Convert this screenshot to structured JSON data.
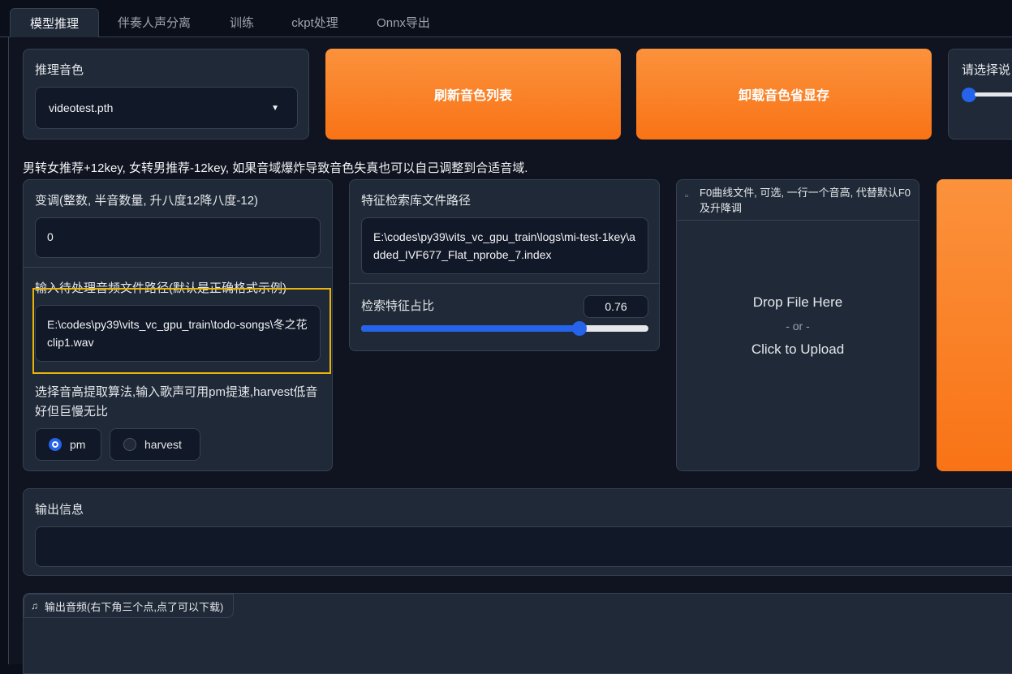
{
  "tabs": [
    "模型推理",
    "伴奏人声分离",
    "训练",
    "ckpt处理",
    "Onnx导出"
  ],
  "voice": {
    "label": "推理音色",
    "selected": "videotest.pth",
    "refresh_button": "刷新音色列表",
    "unload_button": "卸载音色省显存",
    "speaker_label_partial": "请选择说"
  },
  "hint": "男转女推荐+12key, 女转男推荐-12key, 如果音域爆炸导致音色失真也可以自己调整到合适音域.",
  "transpose": {
    "label": "变调(整数, 半音数量, 升八度12降八度-12)",
    "value": "0"
  },
  "input_audio": {
    "label": "输入待处理音频文件路径(默认是正确格式示例)",
    "value": "E:\\codes\\py39\\vits_vc_gpu_train\\todo-songs\\冬之花clip1.wav"
  },
  "f0_method": {
    "label": "选择音高提取算法,输入歌声可用pm提速,harvest低音好但巨慢无比",
    "options": [
      "pm",
      "harvest"
    ],
    "selected": "pm"
  },
  "index": {
    "label": "特征检索库文件路径",
    "value": "E:\\codes\\py39\\vits_vc_gpu_train\\logs\\mi-test-1key\\added_IVF677_Flat_nprobe_7.index"
  },
  "ratio": {
    "label": "检索特征占比",
    "value": "0.76",
    "level": 0.76
  },
  "f0_file": {
    "label": "F0曲线文件, 可选, 一行一个音高, 代替默认F0及升降调",
    "drop_text": "Drop File Here",
    "or_text": "- or -",
    "upload_text": "Click to Upload"
  },
  "output_info": {
    "label": "输出信息",
    "value": ""
  },
  "output_audio": {
    "label": "输出音频(右下角三个点,点了可以下载)"
  },
  "colors": {
    "accent": "#f97316",
    "slider": "#2563eb",
    "background": "#0b0f19",
    "highlight": "#eab308"
  }
}
